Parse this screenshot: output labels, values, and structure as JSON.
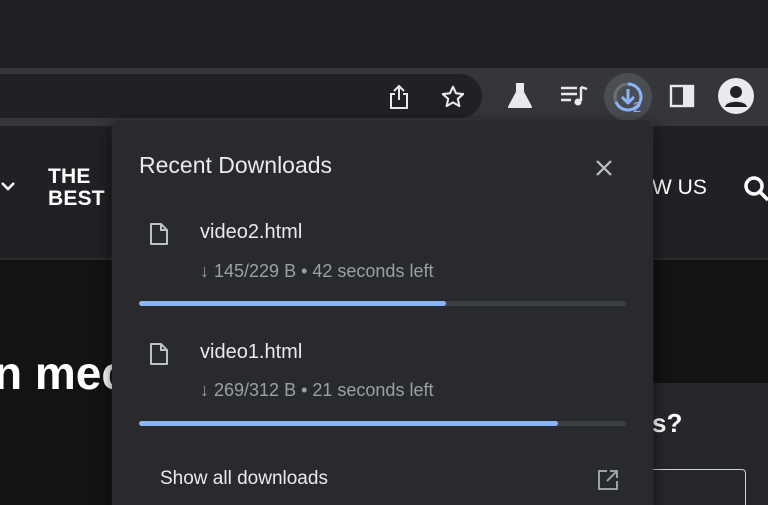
{
  "browser": {
    "download_count": "2"
  },
  "page": {
    "logo_line1": "THE",
    "logo_line2": "BEST",
    "nav_right": "W US",
    "hero_fragment": "n mec",
    "card_fragment": "s?"
  },
  "downloads_popup": {
    "title": "Recent Downloads",
    "items": [
      {
        "filename": "video2.html",
        "status": "↓ 145/229 B • 42 seconds left",
        "progress": 0.63
      },
      {
        "filename": "video1.html",
        "status": "↓ 269/312 B • 21 seconds left",
        "progress": 0.86
      }
    ],
    "show_all_label": "Show all downloads"
  },
  "colors": {
    "accent": "#8ab4f8",
    "popup_bg": "#292a2d",
    "toolbar_bg": "#35363a"
  }
}
